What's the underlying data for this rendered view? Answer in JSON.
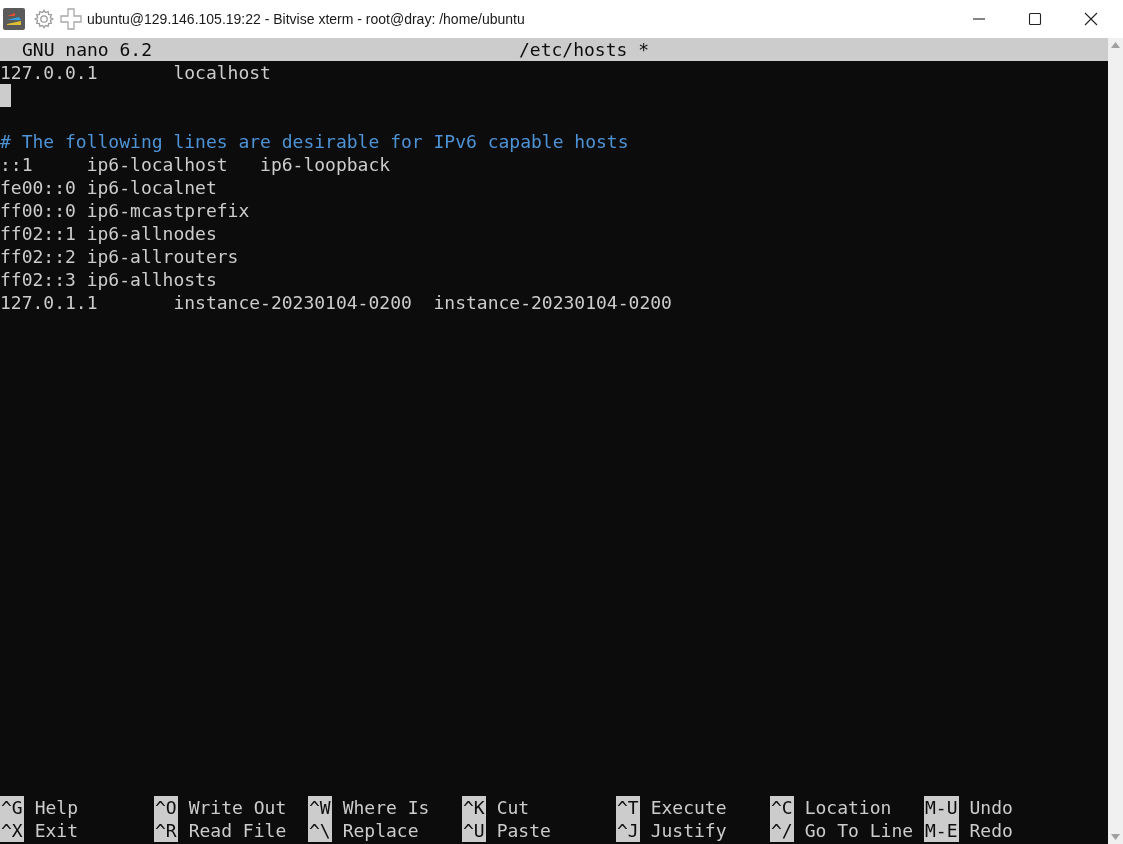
{
  "window": {
    "title": "ubuntu@129.146.105.19:22 - Bitvise xterm - root@dray: /home/ubuntu"
  },
  "editor": {
    "app": "GNU nano 6.2",
    "file": "/etc/hosts *"
  },
  "lines": [
    {
      "kind": "text",
      "text": "127.0.0.1       localhost"
    },
    {
      "kind": "cursor"
    },
    {
      "kind": "blank"
    },
    {
      "kind": "comment",
      "text": "# The following lines are desirable for IPv6 capable hosts"
    },
    {
      "kind": "text",
      "text": "::1     ip6-localhost   ip6-loopback"
    },
    {
      "kind": "text",
      "text": "fe00::0 ip6-localnet"
    },
    {
      "kind": "text",
      "text": "ff00::0 ip6-mcastprefix"
    },
    {
      "kind": "text",
      "text": "ff02::1 ip6-allnodes"
    },
    {
      "kind": "text",
      "text": "ff02::2 ip6-allrouters"
    },
    {
      "kind": "text",
      "text": "ff02::3 ip6-allhosts"
    },
    {
      "kind": "text",
      "text": "127.0.1.1       instance-20230104-0200  instance-20230104-0200"
    }
  ],
  "shortcuts": [
    [
      {
        "key": "^G",
        "label": "Help"
      },
      {
        "key": "^O",
        "label": "Write Out"
      },
      {
        "key": "^W",
        "label": "Where Is"
      },
      {
        "key": "^K",
        "label": "Cut"
      },
      {
        "key": "^T",
        "label": "Execute"
      },
      {
        "key": "^C",
        "label": "Location"
      },
      {
        "key": "M-U",
        "label": "Undo"
      }
    ],
    [
      {
        "key": "^X",
        "label": "Exit"
      },
      {
        "key": "^R",
        "label": "Read File"
      },
      {
        "key": "^\\",
        "label": "Replace"
      },
      {
        "key": "^U",
        "label": "Paste"
      },
      {
        "key": "^J",
        "label": "Justify"
      },
      {
        "key": "^/",
        "label": "Go To Line"
      },
      {
        "key": "M-E",
        "label": "Redo"
      }
    ]
  ]
}
